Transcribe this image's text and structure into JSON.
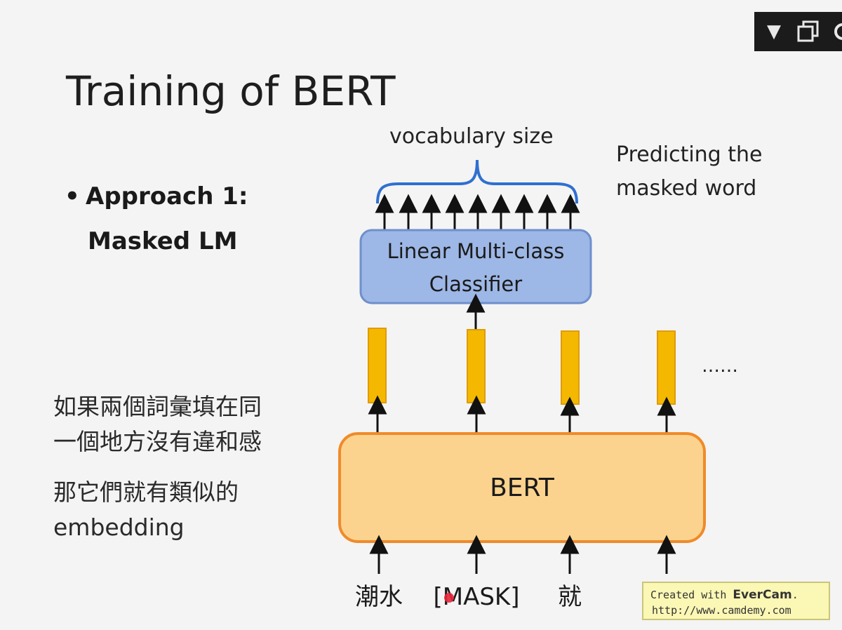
{
  "slide": {
    "title": "Training of BERT",
    "bullet_line1": "Approach 1:",
    "bullet_line2": "Masked LM",
    "bullet_symbol": "•",
    "chinese_line1": "如果兩個詞彙填在同",
    "chinese_line2": "一個地方沒有違和感",
    "chinese_line3": "那它們就有類似的",
    "chinese_line4": "embedding"
  },
  "diagram": {
    "vocab_label": "vocabulary size",
    "predict_line1": "Predicting the",
    "predict_line2": "masked word",
    "classifier_line1": "Linear Multi-class",
    "classifier_line2": "Classifier",
    "bert_label": "BERT",
    "ellipsis": "……",
    "inputs": [
      "潮水",
      "[MASK]",
      "就",
      ""
    ],
    "colors": {
      "classifier_fill": "#9db7e6",
      "classifier_border": "#6f8fcc",
      "bert_fill": "#fcd38e",
      "bert_border": "#f08a2a",
      "vector_fill": "#f5b800",
      "vector_border": "#e09b00",
      "brace": "#2f6fd0"
    }
  },
  "toolbar": {
    "icons": [
      "triangle-down-icon",
      "restore-window-icon",
      "close-icon"
    ]
  },
  "watermark": {
    "line1_prefix": "Created with ",
    "line1_brand": "EverCam",
    "line1_suffix": ".",
    "line2": "http://www.camdemy.com"
  }
}
